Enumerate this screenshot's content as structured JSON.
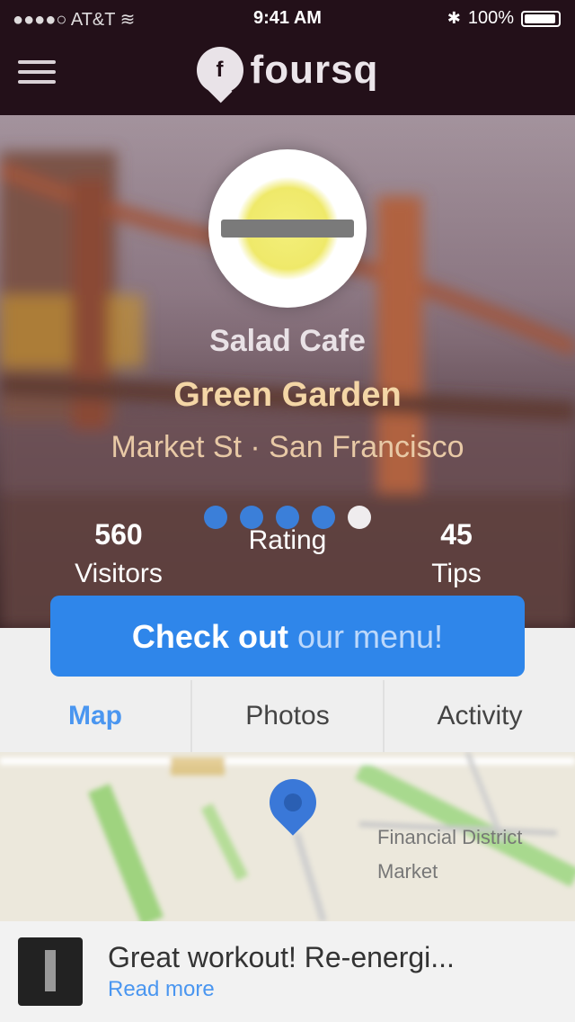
{
  "status_bar": {
    "carrier": "●●●●○ AT&T  ≋",
    "time": "9:41 AM",
    "battery": "100%"
  },
  "navbar": {
    "brand_name": "foursq"
  },
  "venue": {
    "type": "Salad Cafe",
    "name": "Green Garden",
    "address": "Market St · San Francisco",
    "rating_dots": [
      true,
      true,
      true,
      true,
      false
    ]
  },
  "stats": [
    {
      "num": "560",
      "label": "Visitors"
    },
    {
      "num": "",
      "label": "Rating"
    },
    {
      "num": "45",
      "label": "Tips"
    }
  ],
  "checkin_button": {
    "strong": "Check out",
    "soft": "our menu!"
  },
  "tabs": [
    {
      "label": "Map",
      "active": true
    },
    {
      "label": "Photos",
      "active": false
    },
    {
      "label": "Activity",
      "active": false
    }
  ],
  "map": {
    "labels": [
      "Financial District",
      "Market"
    ]
  },
  "tip": {
    "text": "Great workout! Re-energi...",
    "link": "Read more"
  }
}
